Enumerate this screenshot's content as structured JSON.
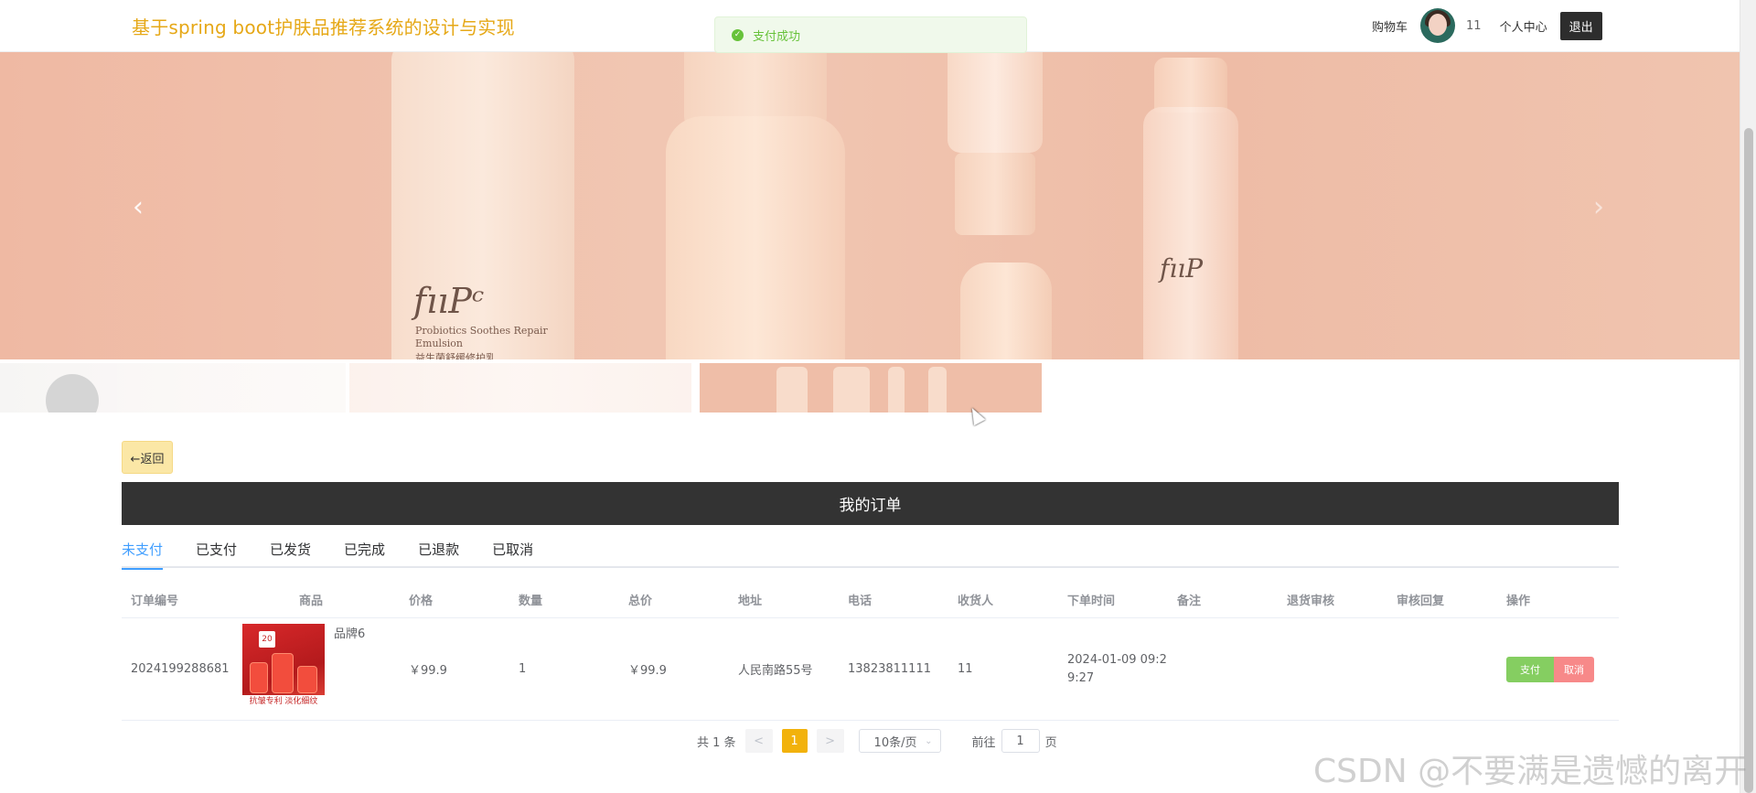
{
  "header": {
    "site_title": "基于spring boot护肤品推荐系统的设计与实现",
    "cart_label": "购物车",
    "username": "11",
    "profile_label": "个人中心",
    "logout_label": "退出"
  },
  "toast": {
    "message": "支付成功",
    "color": "#67c23a"
  },
  "banner": {
    "prev_arrow": "‹",
    "next_arrow": "›",
    "label_line1": "Probiotics Soothes Repair",
    "label_line2": "Emulsion",
    "label_cn": "益生菌舒缓修护乳"
  },
  "back_button": {
    "label": "←返回"
  },
  "orders": {
    "title": "我的订单",
    "tabs": [
      {
        "label": "未支付",
        "active": true
      },
      {
        "label": "已支付"
      },
      {
        "label": "已发货"
      },
      {
        "label": "已完成"
      },
      {
        "label": "已退款"
      },
      {
        "label": "已取消"
      }
    ],
    "columns": [
      "订单编号",
      "商品",
      "价格",
      "数量",
      "总价",
      "地址",
      "电话",
      "收货人",
      "下单时间",
      "备注",
      "退货审核",
      "审核回复",
      "操作"
    ],
    "rows": [
      {
        "order_no": "2024199288681",
        "goods_name": "品牌6",
        "goods_img_caption": "抗皱专利 淡化细纹",
        "price": "￥99.9",
        "qty": "1",
        "total": "￥99.9",
        "address": "人民南路55号",
        "phone": "13823811111",
        "receiver": "11",
        "time_line1": "2024-01-09 09:2",
        "time_line2": "9:27",
        "note": "",
        "return_review": "",
        "review_reply": "",
        "pay_label": "支付",
        "cancel_label": "取消"
      }
    ]
  },
  "pagination": {
    "total_text": "共 1 条",
    "prev": "<",
    "current_page": "1",
    "next": ">",
    "page_size": "10条/页",
    "goto_label": "前往",
    "goto_value": "1",
    "goto_suffix": "页"
  },
  "watermark": "CSDN @不要满是遗憾的离开",
  "colors": {
    "accent": "#409eff",
    "title": "#e6a817",
    "page_active": "#f2b20c"
  }
}
